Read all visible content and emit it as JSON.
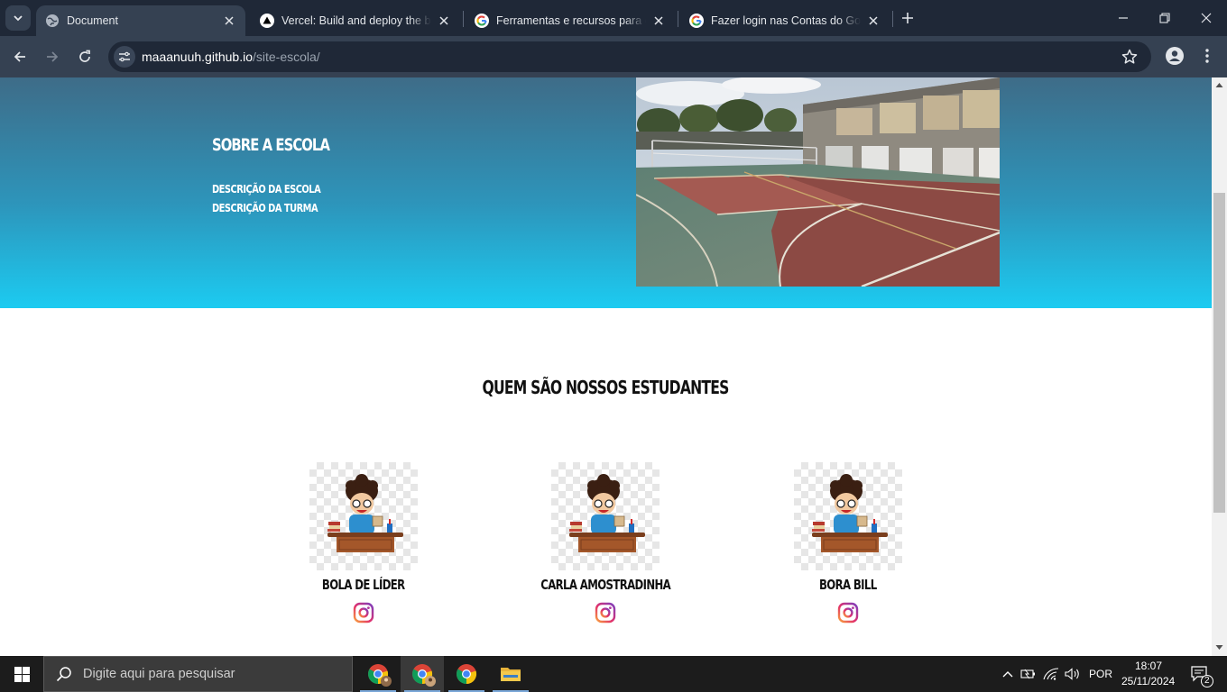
{
  "browser": {
    "tabs": [
      {
        "title": "Document",
        "active": true,
        "favicon": "globe-icon"
      },
      {
        "title": "Vercel: Build and deploy the best",
        "active": false,
        "favicon": "vercel-icon"
      },
      {
        "title": "Ferramentas e recursos para o G",
        "active": false,
        "favicon": "google-icon"
      },
      {
        "title": "Fazer login nas Contas do Google",
        "active": false,
        "favicon": "google-icon"
      }
    ],
    "url_host": "maaanuuh.github.io",
    "url_path": "/site-escola/"
  },
  "page": {
    "hero": {
      "title": "SOBRE A ESCOLA",
      "links": [
        "DESCRIÇÃO DA ESCOLA",
        "DESCRIÇÃO DA TURMA"
      ]
    },
    "students_section": {
      "title": "QUEM SÃO NOSSOS ESTUDANTES",
      "students": [
        {
          "name": "BOLA DE LÍDER",
          "social": "instagram-icon"
        },
        {
          "name": "CARLA AMOSTRADINHA",
          "social": "instagram-icon"
        },
        {
          "name": "BORA BILL",
          "social": "instagram-icon"
        }
      ]
    }
  },
  "taskbar": {
    "search_placeholder": "Digite aqui para pesquisar",
    "language": "POR",
    "time": "18:07",
    "date": "25/11/2024",
    "notifications": "2"
  },
  "colors": {
    "hero_top": "#3e6c88",
    "hero_bottom": "#1ccbf1",
    "tab_bar": "#1f2837",
    "toolbar": "#354152"
  }
}
